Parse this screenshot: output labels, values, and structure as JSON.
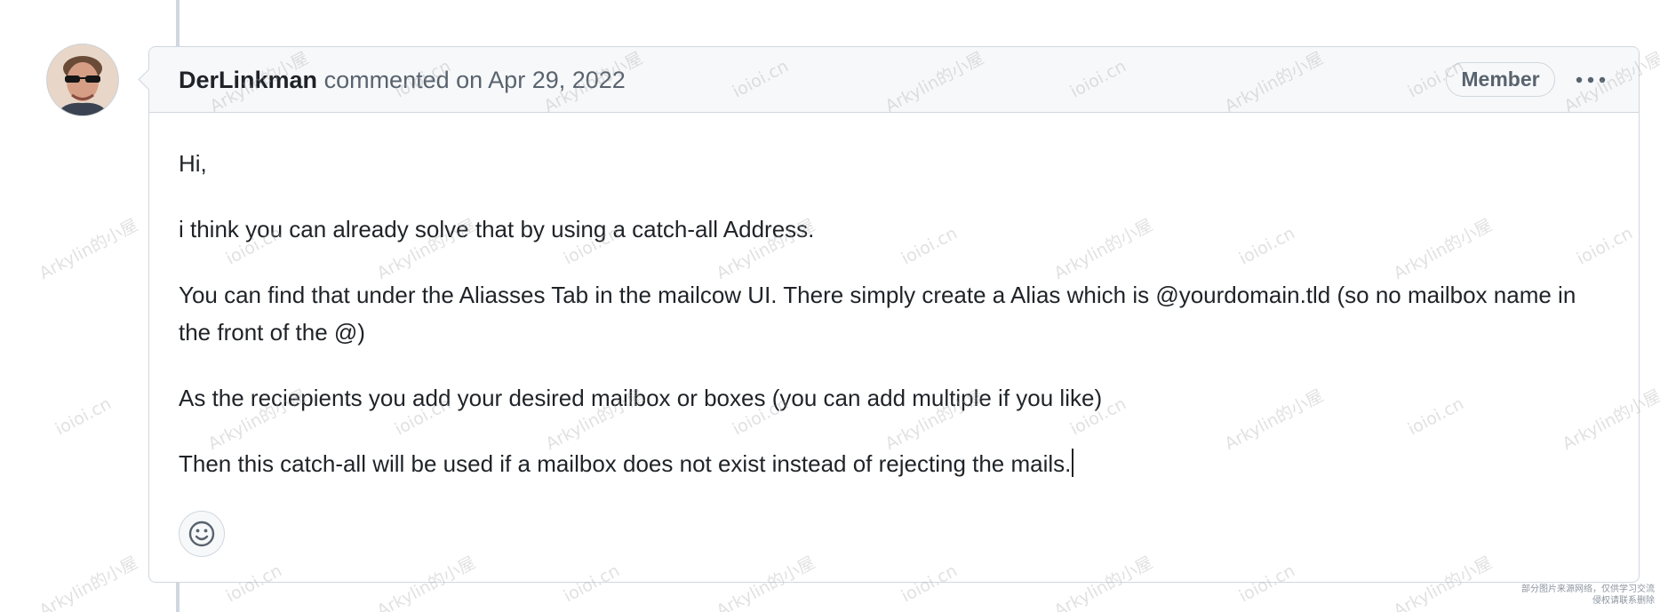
{
  "comment": {
    "author": "DerLinkman",
    "meta": "commented on Apr 29, 2022",
    "role_badge": "Member",
    "paragraphs": [
      "Hi,",
      "i think you can already solve that by using a catch-all Address.",
      "You can find that under the Aliasses Tab in the mailcow UI. There simply create a Alias which is @yourdomain.tld (so no mailbox name in the front of the @)",
      "As the reciepients you add your desired mailbox or boxes (you can add multiple if you like)",
      "Then this catch-all will be used if a mailbox does not exist instead of rejecting the mails."
    ]
  },
  "icons": {
    "avatar": "user-avatar",
    "more_options": "kebab-horizontal-icon",
    "add_reaction": "smiley-icon"
  },
  "footer_note": {
    "line1": "部分图片来源网络，仅供学习交流",
    "line2": "侵权请联系删除"
  },
  "watermark": {
    "text_a": "Arkylin的小屋",
    "text_b": "ioioi.cn"
  },
  "colors": {
    "border": "#d0d7de",
    "header_bg": "#f6f8fa",
    "muted_text": "#59636e",
    "text": "#1f2328"
  }
}
